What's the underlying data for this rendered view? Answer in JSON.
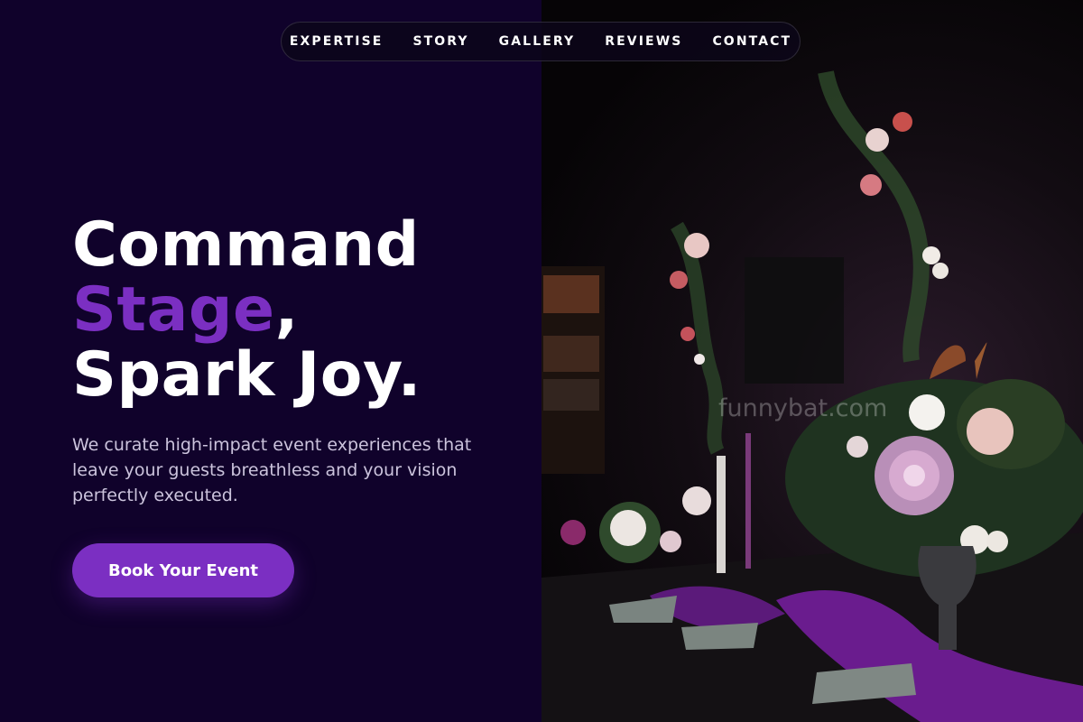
{
  "nav": {
    "items": [
      "EXPERTISE",
      "STORY",
      "GALLERY",
      "REVIEWS",
      "CONTACT"
    ]
  },
  "hero": {
    "title_line1": "Command",
    "title_accent": "Stage",
    "title_comma": ",",
    "title_line3": "Spark Joy.",
    "subtitle": "We curate high-impact event experiences that leave your guests breathless and your vision perfectly executed.",
    "cta_label": "Book Your Event"
  },
  "photo": {
    "watermark": "funnybat.com",
    "subject": "dark banquet table with floral centerpieces, candles and purple napkins"
  },
  "colors": {
    "background": "#10022b",
    "accent": "#7b2fc2",
    "text": "#ffffff",
    "subtitle_text": "#cbc3dc"
  }
}
